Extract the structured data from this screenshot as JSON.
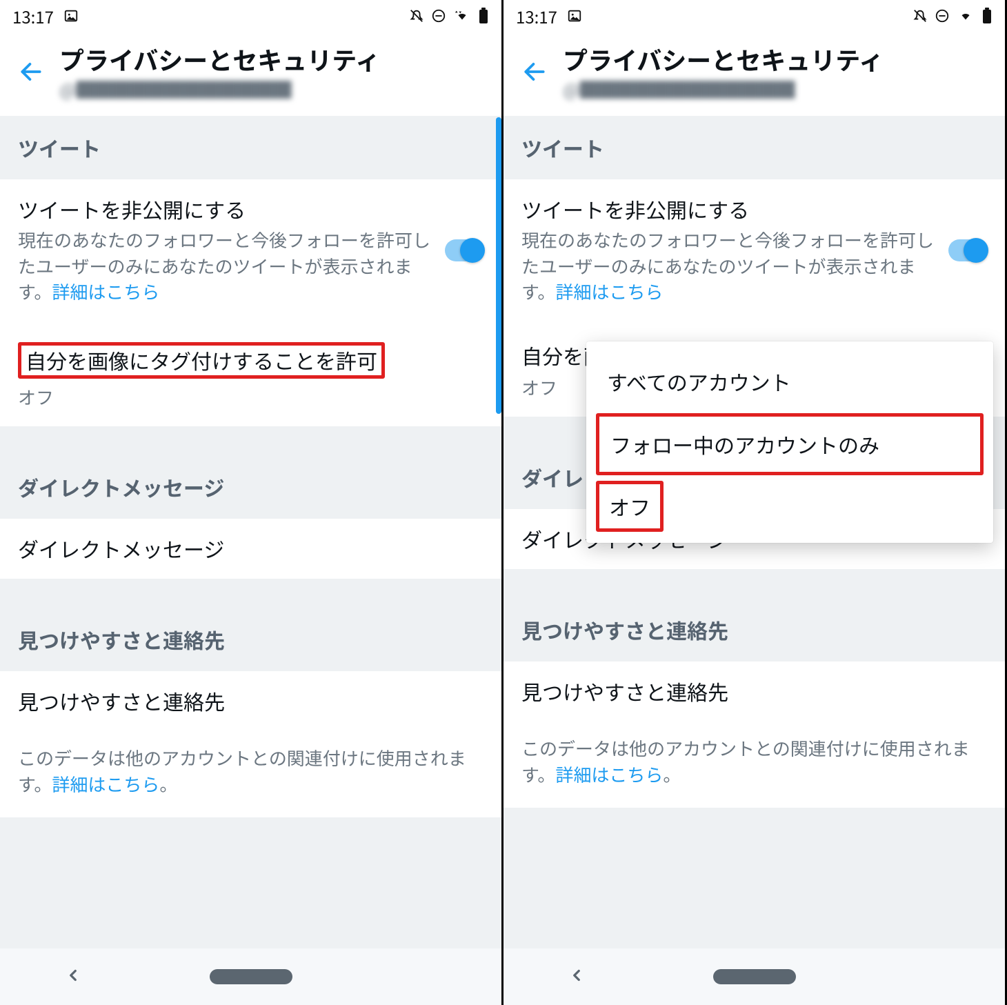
{
  "status": {
    "time": "13:17"
  },
  "header": {
    "title": "プライバシーとセキュリティ",
    "subtitle_prefix": "@"
  },
  "sections": {
    "tweets": {
      "header": "ツイート",
      "protect": {
        "title": "ツイートを非公開にする",
        "desc_a": "現在のあなたのフォロワーと今後フォローを許可したユーザーのみにあなたのツイートが表示されます。",
        "desc_link": "詳細はこちら",
        "toggle": true
      },
      "tagging": {
        "title": "自分を画像にタグ付けすることを許可",
        "value": "オフ"
      }
    },
    "dm": {
      "header": "ダイレクトメッセージ",
      "row_title": "ダイレクトメッセージ"
    },
    "discover": {
      "header": "見つけやすさと連絡先",
      "row_title": "見つけやすさと連絡先",
      "foot_a": "このデータは他のアカウントとの関連付けに使用されます。",
      "foot_link": "詳細はこちら",
      "foot_b": "。"
    }
  },
  "popup": {
    "opt_all": "すべてのアカウント",
    "opt_following": "フォロー中のアカウントのみ",
    "opt_off": "オフ"
  },
  "right_tag_row": {
    "title_visible": "自分を画",
    "value": "オフ"
  },
  "right_dm_header_visible": "ダイレ"
}
